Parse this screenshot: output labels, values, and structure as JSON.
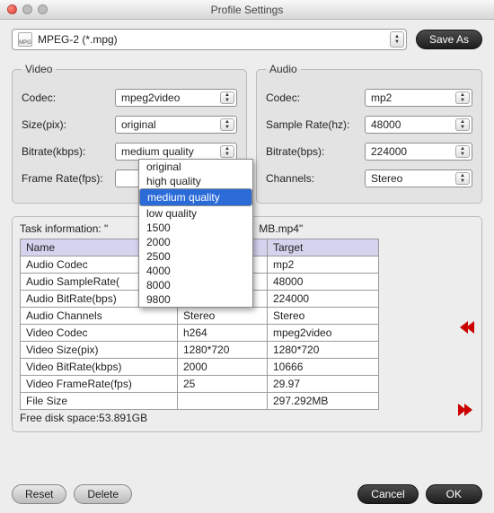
{
  "window": {
    "title": "Profile Settings"
  },
  "profile": {
    "label": "MPEG-2 (*.mpg)",
    "icon_name": "MPG"
  },
  "buttons": {
    "save_as": "Save As",
    "reset": "Reset",
    "delete": "Delete",
    "cancel": "Cancel",
    "ok": "OK"
  },
  "video": {
    "legend": "Video",
    "codec_label": "Codec:",
    "codec_value": "mpeg2video",
    "size_label": "Size(pix):",
    "size_value": "original",
    "bitrate_label": "Bitrate(kbps):",
    "bitrate_value": "medium quality",
    "framerate_label": "Frame Rate(fps):",
    "framerate_value": ""
  },
  "audio": {
    "legend": "Audio",
    "codec_label": "Codec:",
    "codec_value": "mp2",
    "sr_label": "Sample Rate(hz):",
    "sr_value": "48000",
    "bitrate_label": "Bitrate(bps):",
    "bitrate_value": "224000",
    "channels_label": "Channels:",
    "channels_value": "Stereo"
  },
  "bitrate_options": {
    "o0": "original",
    "o1": "high quality",
    "o2": "medium quality",
    "o3": "low quality",
    "o4": "1500",
    "o5": "2000",
    "o6": "2500",
    "o7": "4000",
    "o8": "8000",
    "o9": "9800",
    "selected": "medium quality"
  },
  "task": {
    "title_prefix": "Task information: \"",
    "title_suffix": "MB.mp4\"",
    "headers": {
      "name": "Name",
      "source": "",
      "target": "Target"
    },
    "rows": [
      {
        "name": "Audio Codec",
        "source": "",
        "target": "mp2"
      },
      {
        "name": "Audio SampleRate(",
        "source": "",
        "target": "48000"
      },
      {
        "name": "Audio BitRate(bps)",
        "source": "",
        "target": "224000"
      },
      {
        "name": "Audio Channels",
        "source": "Stereo",
        "target": "Stereo"
      },
      {
        "name": "Video Codec",
        "source": "h264",
        "target": "mpeg2video"
      },
      {
        "name": "Video Size(pix)",
        "source": "1280*720",
        "target": "1280*720"
      },
      {
        "name": "Video BitRate(kbps)",
        "source": "2000",
        "target": "10666"
      },
      {
        "name": "Video FrameRate(fps)",
        "source": "25",
        "target": "29.97"
      },
      {
        "name": "File Size",
        "source": "",
        "target": "297.292MB"
      }
    ],
    "free_disk_label": "Free disk space:",
    "free_disk_value": "53.891GB"
  }
}
